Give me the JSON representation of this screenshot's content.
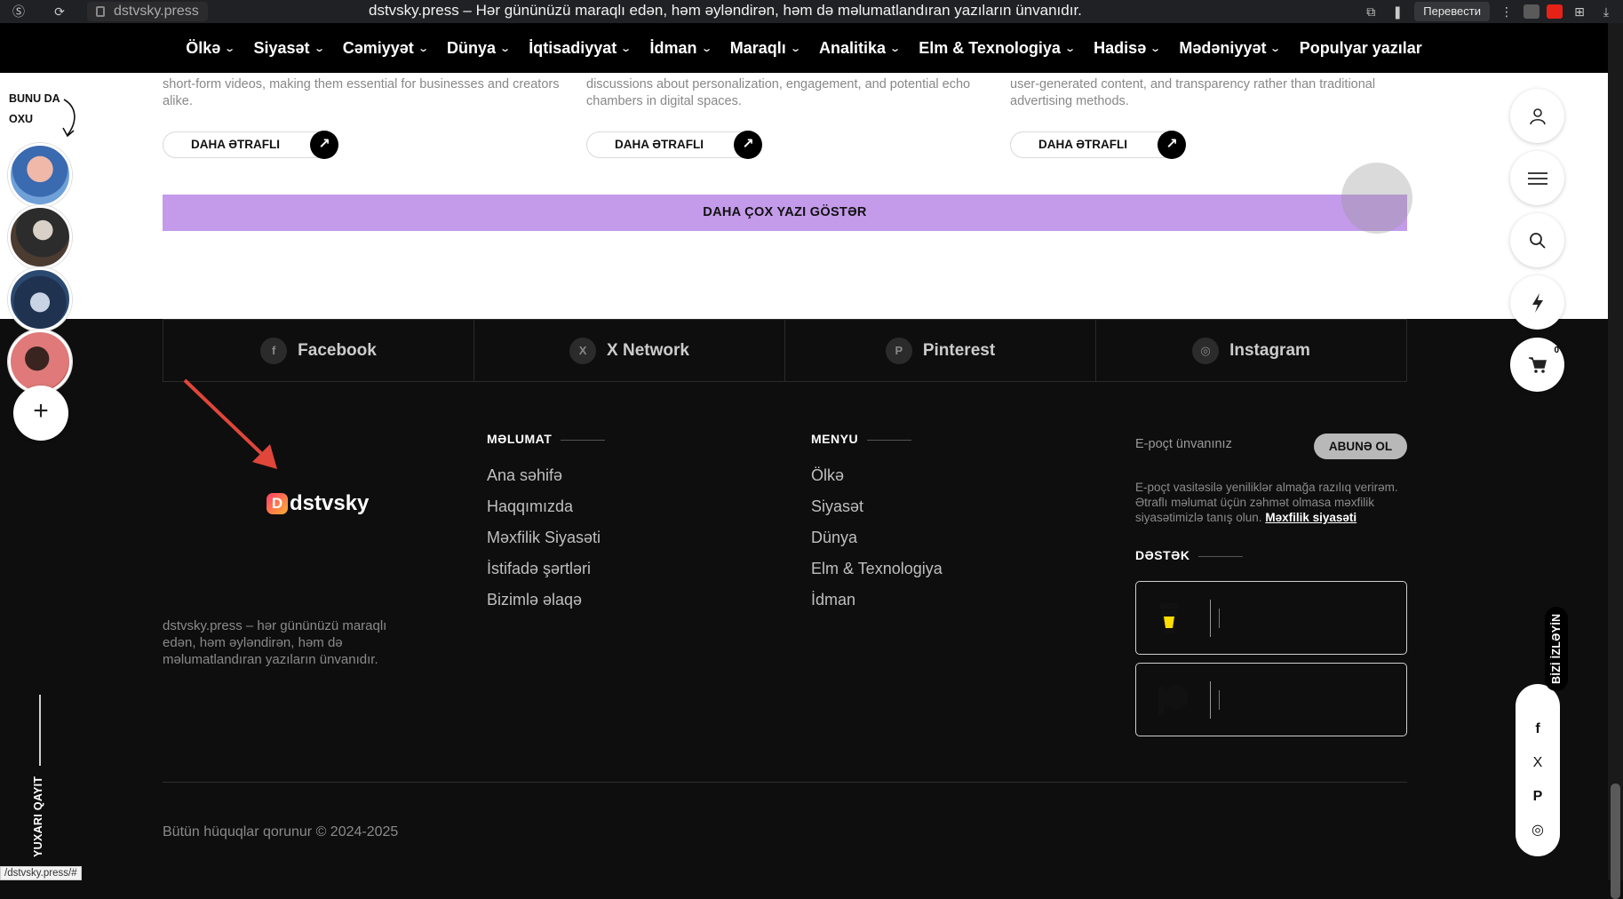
{
  "browser": {
    "url": "dstvsky.press",
    "tab_title": "dstvsky.press – Hər gününüzü maraqlı edən, həm əyləndirən, həm də məlumatlandıran yazıların ünvanıdır.",
    "translate_label": "Перевести",
    "status_url": "/dstvsky.press/#"
  },
  "nav": {
    "items": [
      {
        "label": "Ölkə",
        "dropdown": true
      },
      {
        "label": "Siyasət",
        "dropdown": true
      },
      {
        "label": "Cəmiyyət",
        "dropdown": true
      },
      {
        "label": "Dünya",
        "dropdown": true
      },
      {
        "label": "İqtisadiyyat",
        "dropdown": true
      },
      {
        "label": "İdman",
        "dropdown": true
      },
      {
        "label": "Maraqlı",
        "dropdown": true
      },
      {
        "label": "Analitika",
        "dropdown": true
      },
      {
        "label": "Elm & Texnologiya",
        "dropdown": true
      },
      {
        "label": "Hadisə",
        "dropdown": true
      },
      {
        "label": "Mədəniyyət",
        "dropdown": true
      },
      {
        "label": "Populyar yazılar",
        "dropdown": false
      }
    ]
  },
  "cards": [
    {
      "text": "short-form videos, making them essential for businesses and creators alike.",
      "button": "DAHA ƏTRAFLI"
    },
    {
      "text": "discussions about personalization, engagement, and potential echo chambers in digital spaces.",
      "button": "DAHA ƏTRAFLI"
    },
    {
      "text": "user-generated content, and transparency rather than traditional advertising methods.",
      "button": "DAHA ƏTRAFLI"
    }
  ],
  "more_posts_label": "DAHA ÇOX YAZI GÖSTƏR",
  "social": [
    {
      "name": "Facebook",
      "icon": "f"
    },
    {
      "name": "X Network",
      "icon": "X"
    },
    {
      "name": "Pinterest",
      "icon": "P"
    },
    {
      "name": "Instagram",
      "icon": "◎"
    }
  ],
  "footer": {
    "logo_text": "dstvsky",
    "description": "dstvsky.press – hər gününüzü maraqlı edən, həm əyləndirən, həm də məlumatlandıran yazıların ünvanıdır.",
    "info_heading": "MƏLUMAT",
    "info_links": [
      "Ana səhifə",
      "Haqqımızda",
      "Məxfilik Siyasəti",
      "İstifadə şərtləri",
      "Bizimlə əlaqə"
    ],
    "menu_heading": "MENYU",
    "menu_links": [
      "Ölkə",
      "Siyasət",
      "Dünya",
      "Elm & Texnologiya",
      "İdman"
    ],
    "email_placeholder": "E-poçt ünvanınız",
    "subscribe_label": "ABUNƏ OL",
    "consent_text": "E-poçt vasitəsilə yeniliklər almağa razılıq verirəm. Ətraflı məlumat üçün zəhmət olmasa məxfilik siyasətimizlə tanış olun.",
    "consent_link": "Məxfilik siyasəti",
    "support_heading": "DƏSTƏK",
    "copyright": "Bütün hüquqlar qorunur © 2024-2025"
  },
  "left_rail": {
    "read_also": [
      "BUNU DA",
      "OXU"
    ],
    "back_to_top": "YUXARI QAYIT"
  },
  "right_rail": {
    "cart_count": "0",
    "follow_label": "BİZİ İZLƏYİN",
    "follow_icons": [
      "f",
      "X",
      "P",
      "◎"
    ]
  },
  "colors": {
    "accent_purple": "#c49bea",
    "footer_bg": "#0e0e0e",
    "nav_bg": "#000000"
  }
}
